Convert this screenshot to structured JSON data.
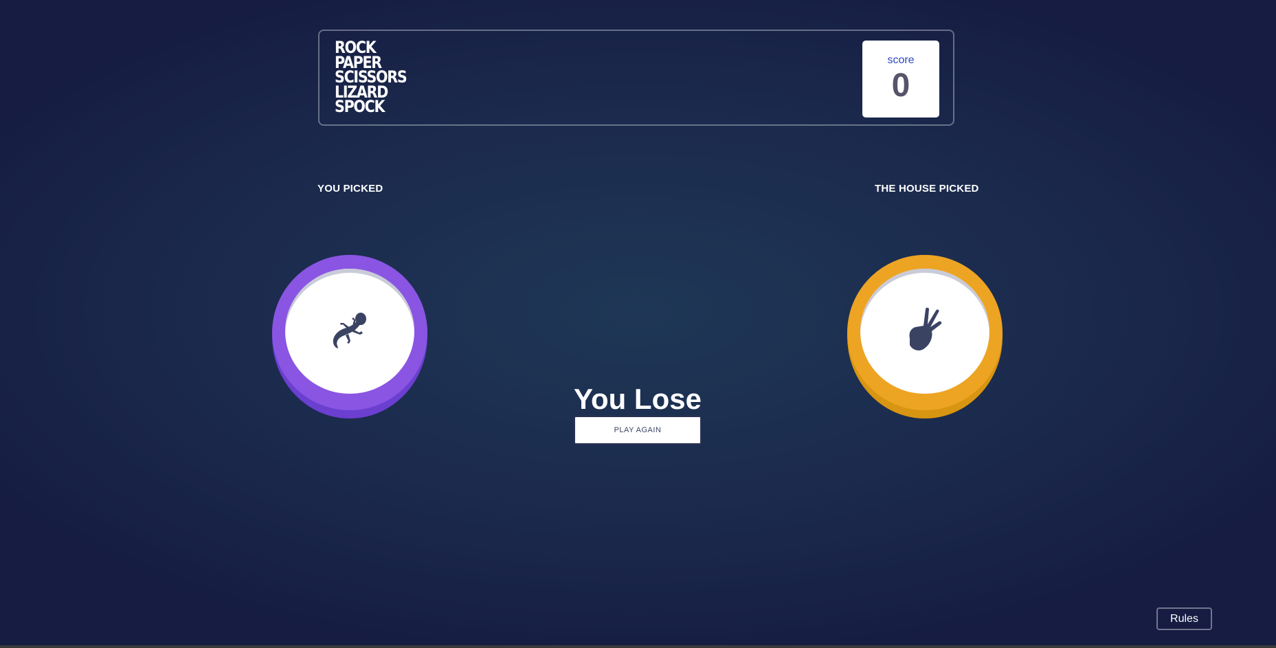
{
  "header": {
    "title_lines": [
      "ROCK",
      "PAPER",
      "SCISSORS",
      "LIZARD",
      "SPOCK"
    ],
    "score_label": "score",
    "score_value": "0"
  },
  "picks": {
    "user_label": "YOU PICKED",
    "house_label": "THE HOUSE PICKED",
    "user_choice": {
      "name": "lizard",
      "icon": "lizard-icon",
      "color": "#8a55e3"
    },
    "house_choice": {
      "name": "spock",
      "icon": "spock-hand-icon",
      "color": "#eda423"
    }
  },
  "result": {
    "text": "You Lose",
    "play_again_label": "PLAY AGAIN"
  },
  "footer": {
    "rules_label": "Rules"
  },
  "colors": {
    "background": "#1b2a4d",
    "icon": "#3b4363",
    "score_label": "#2a46c0"
  }
}
